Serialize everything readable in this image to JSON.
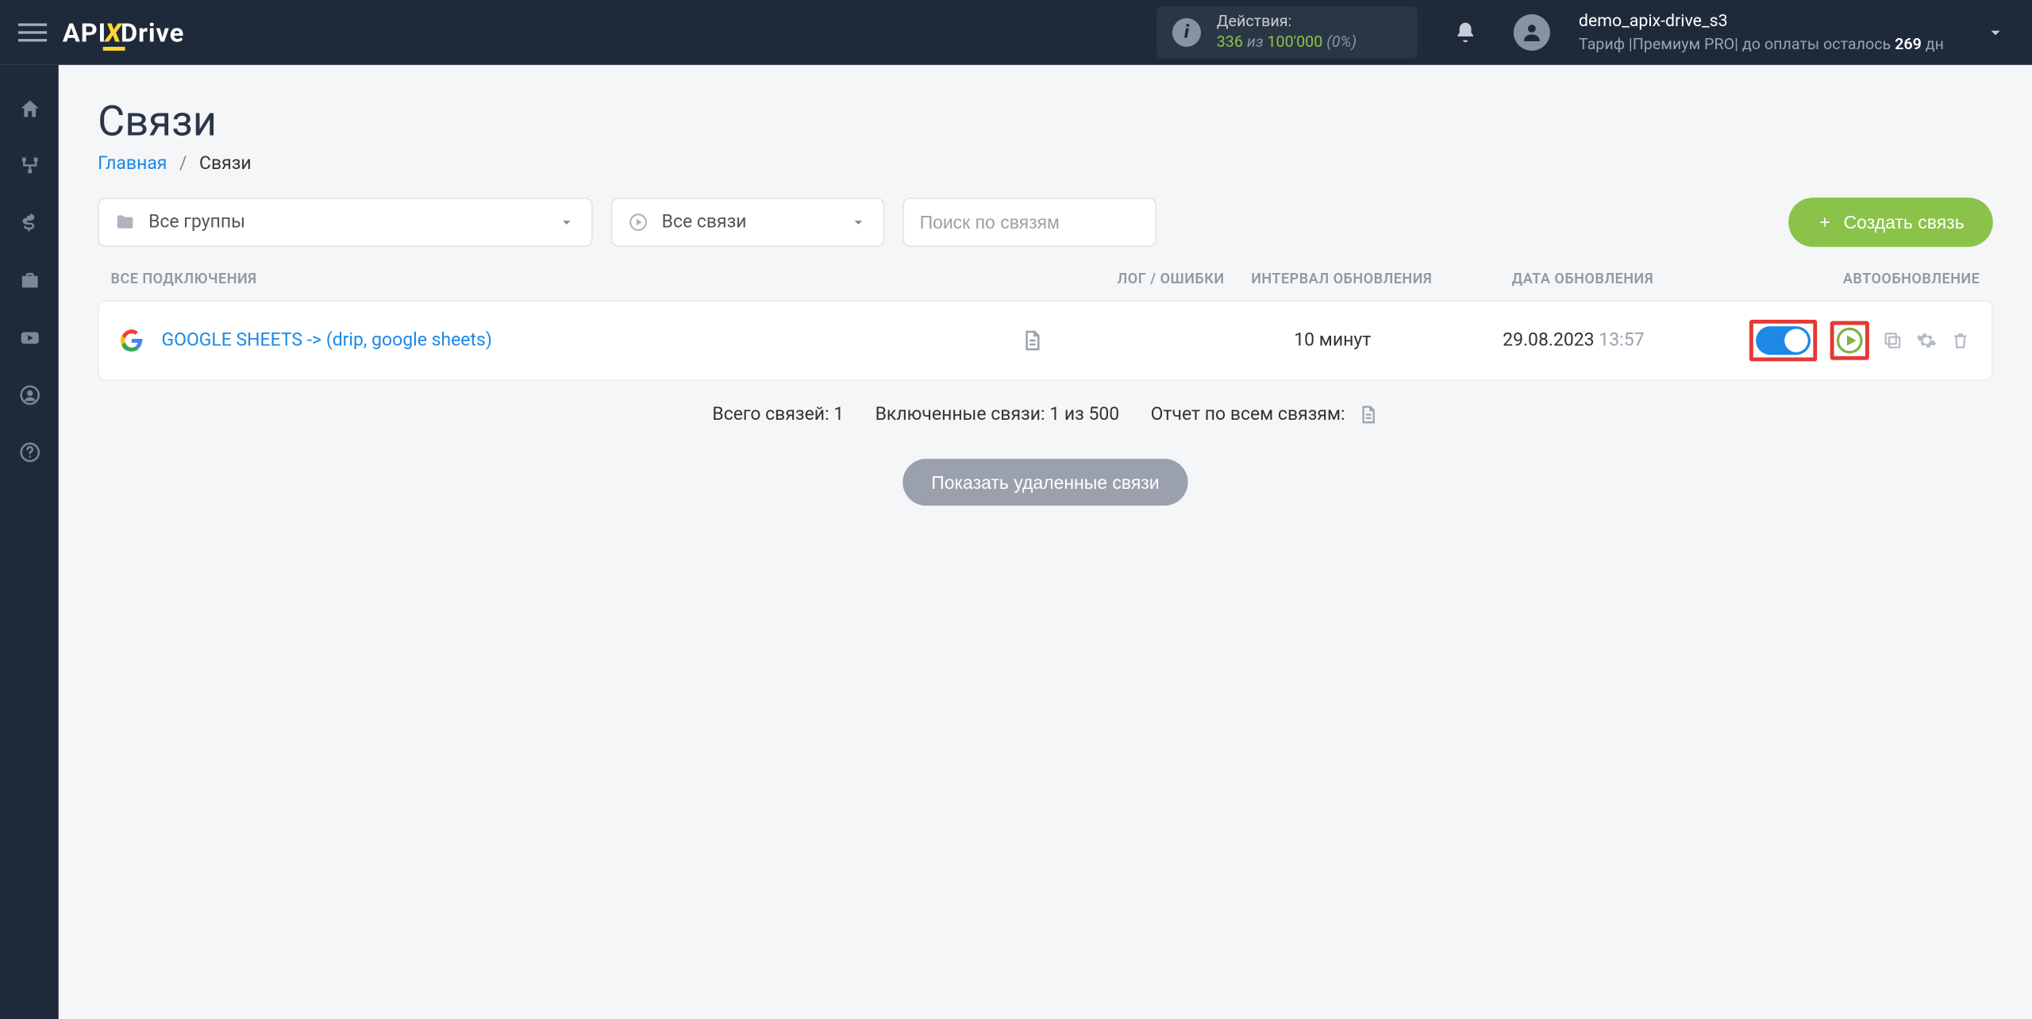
{
  "header": {
    "actions_label": "Действия:",
    "actions_used": "336",
    "actions_sep": "из",
    "actions_total": "100'000",
    "actions_pct": "(0%)",
    "username": "demo_apix-drive_s3",
    "tariff_prefix": "Тариф |",
    "tariff_name": "Премиум PRO",
    "tariff_suffix1": "| до оплаты осталось ",
    "tariff_days": "269",
    "tariff_suffix2": " дн"
  },
  "page": {
    "title": "Связи",
    "breadcrumb_home": "Главная",
    "breadcrumb_current": "Связи"
  },
  "toolbar": {
    "group_select": "Все группы",
    "status_select": "Все связи",
    "search_placeholder": "Поиск по связям",
    "create_button": "Создать связь"
  },
  "columns": {
    "c1": "Все подключения",
    "c2": "Лог / Ошибки",
    "c3": "Интервал обновления",
    "c4": "Дата обновления",
    "c5": "Автообновление"
  },
  "rows": [
    {
      "name": "GOOGLE SHEETS -> (drip, google sheets)",
      "interval": "10 минут",
      "date": "29.08.2023",
      "time": "13:57"
    }
  ],
  "summary": {
    "total": "Всего связей: 1",
    "enabled": "Включенные связи: 1 из 500",
    "report": "Отчет по всем связям:"
  },
  "deleted_button": "Показать удаленные связи"
}
